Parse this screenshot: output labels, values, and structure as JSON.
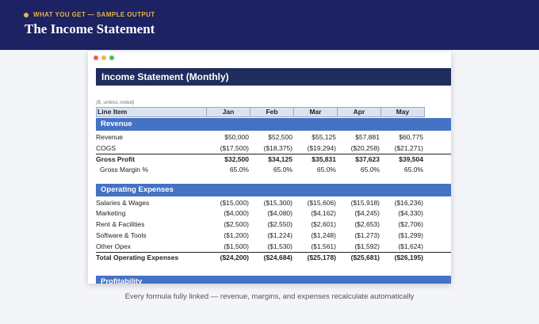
{
  "header": {
    "eyebrow": "WHAT YOU GET — SAMPLE OUTPUT",
    "title": "The Income Statement"
  },
  "sheet": {
    "title": "Income Statement (Monthly)",
    "units_note": "($, unless noted)",
    "columns": [
      "Line Item",
      "Jan",
      "Feb",
      "Mar",
      "Apr",
      "May"
    ],
    "sections": {
      "revenue": "Revenue",
      "opex": "Operating Expenses",
      "profit": "Profitability"
    },
    "rows": {
      "revenue": {
        "label": "Revenue",
        "values": [
          "$50,000",
          "$52,500",
          "$55,125",
          "$57,881",
          "$60,775"
        ]
      },
      "cogs": {
        "label": "COGS",
        "values": [
          "($17,500)",
          "($18,375)",
          "($19,294)",
          "($20,258)",
          "($21,271)"
        ]
      },
      "gross_profit": {
        "label": "Gross Profit",
        "values": [
          "$32,500",
          "$34,125",
          "$35,831",
          "$37,623",
          "$39,504"
        ]
      },
      "gross_margin": {
        "label": "Gross Margin %",
        "values": [
          "65.0%",
          "65.0%",
          "65.0%",
          "65.0%",
          "65.0%"
        ]
      },
      "salaries": {
        "label": "Salaries & Wages",
        "values": [
          "($15,000)",
          "($15,300)",
          "($15,606)",
          "($15,918)",
          "($16,236)"
        ]
      },
      "marketing": {
        "label": "Marketing",
        "values": [
          "($4,000)",
          "($4,080)",
          "($4,162)",
          "($4,245)",
          "($4,330)"
        ]
      },
      "rent": {
        "label": "Rent & Facilities",
        "values": [
          "($2,500)",
          "($2,550)",
          "($2,601)",
          "($2,653)",
          "($2,706)"
        ]
      },
      "software": {
        "label": "Software & Tools",
        "values": [
          "($1,200)",
          "($1,224)",
          "($1,248)",
          "($1,273)",
          "($1,299)"
        ]
      },
      "other": {
        "label": "Other Opex",
        "values": [
          "($1,500)",
          "($1,530)",
          "($1,561)",
          "($1,592)",
          "($1,624)"
        ]
      },
      "total_opex": {
        "label": "Total Operating Expenses",
        "values": [
          "($24,200)",
          "($24,684)",
          "($25,178)",
          "($25,681)",
          "($26,195)"
        ]
      }
    }
  },
  "caption": "Every formula fully linked — revenue, margins, and expenses recalculate automatically",
  "colors": {
    "header_bg": "#1d2263",
    "accent": "#e8b54c",
    "sheet_title_bg": "#1f2d5c",
    "section_bg": "#4472c4"
  }
}
